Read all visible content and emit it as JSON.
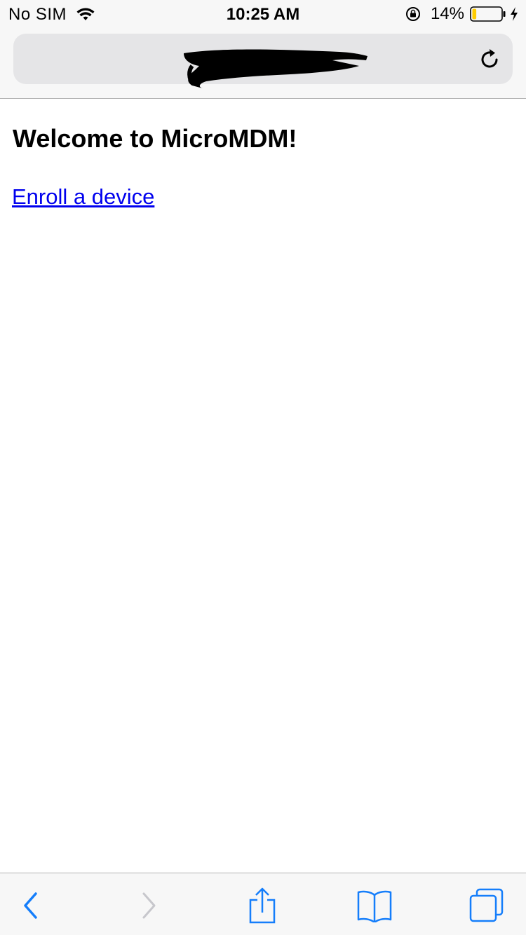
{
  "status_bar": {
    "carrier": "No SIM",
    "time": "10:25 AM",
    "battery_percent": "14%",
    "battery_level": 0.14,
    "battery_color": "#ffcc00"
  },
  "address_bar": {
    "url_redacted": true
  },
  "page": {
    "heading": "Welcome to MicroMDM!",
    "enroll_link": "Enroll a device",
    "link_color": "#0000ee"
  },
  "toolbar": {
    "back": "back-icon",
    "forward": "forward-icon",
    "share": "share-icon",
    "bookmarks": "bookmarks-icon",
    "tabs": "tabs-icon",
    "accent_color": "#157efb"
  }
}
